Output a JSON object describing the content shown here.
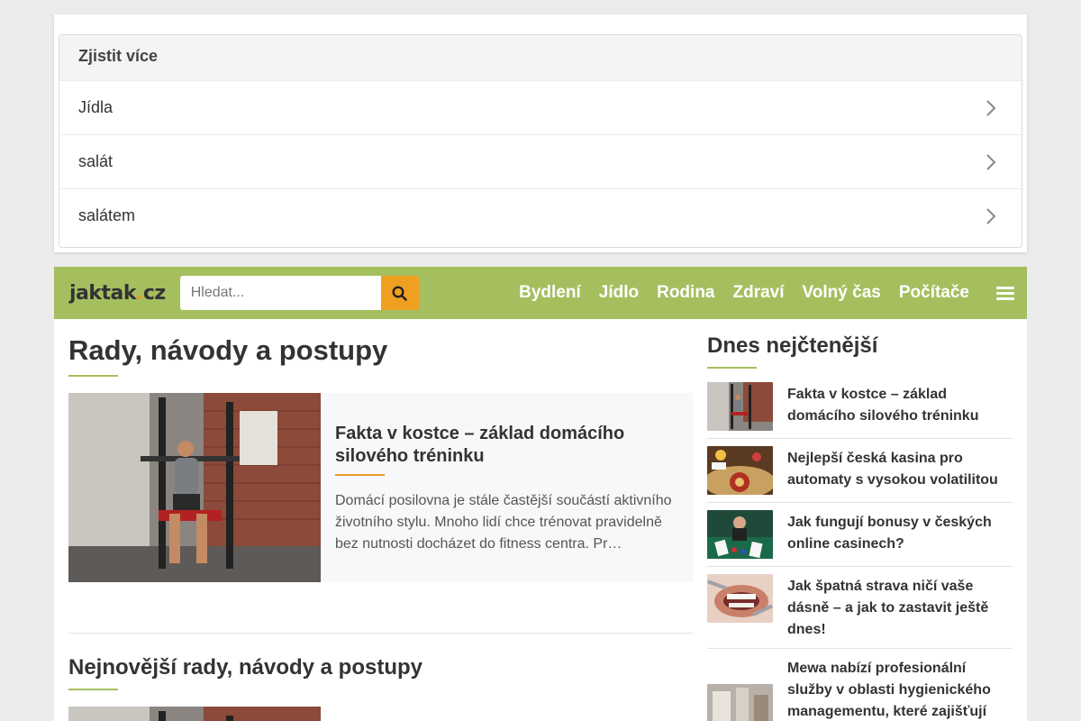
{
  "learn_more": {
    "title": "Zjistit více",
    "items": [
      {
        "label": "Jídla"
      },
      {
        "label": "salát"
      },
      {
        "label": "salátem"
      }
    ]
  },
  "header": {
    "logo": {
      "name": "jaktak",
      "dot": ".",
      "tld": "cz"
    },
    "search": {
      "placeholder": "Hledat..."
    },
    "nav": [
      {
        "label": "Bydlení"
      },
      {
        "label": "Jídlo"
      },
      {
        "label": "Rodina"
      },
      {
        "label": "Zdraví"
      },
      {
        "label": "Volný čas"
      },
      {
        "label": "Počítače"
      }
    ],
    "accent_color": "#a5bf5f",
    "search_button_color": "#f0a020"
  },
  "main": {
    "title": "Rady, návody a postupy",
    "featured": {
      "title": "Fakta v kostce – základ domácího silového tréninku",
      "excerpt": "Domácí posilovna je stále častější součástí aktivního životního stylu. Mnoho lidí chce trénovat pravidelně bez nutnosti docházet do fitness centra. Pr…"
    },
    "latest_title": "Nejnovější rady, návody a postupy"
  },
  "sidebar": {
    "title": "Dnes nejčtenější",
    "items": [
      {
        "title": "Fakta v kostce – základ domácího silového tréninku"
      },
      {
        "title": "Nejlepší česká kasina pro automaty s vysokou volatilitou"
      },
      {
        "title": "Jak fungují bonusy v českých online casinech?"
      },
      {
        "title": "Jak špatná strava ničí vaše dásně – a jak to zastavit ještě dnes!"
      },
      {
        "title": "Mewa nabízí profesionální služby v oblasti hygienického managementu, které zajišťují"
      }
    ]
  }
}
